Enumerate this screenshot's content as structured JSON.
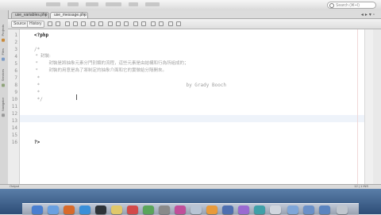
{
  "search": {
    "placeholder": "Search (⌘+I)"
  },
  "tabs": [
    {
      "label": "use_variables.php"
    },
    {
      "label": "use_message.php"
    }
  ],
  "side_panel": {
    "items": [
      "Projects",
      "Files",
      "Services",
      "Navigator"
    ]
  },
  "toolbar": {
    "source_label": "Source",
    "history_label": "History"
  },
  "editor": {
    "line_numbers": [
      "1",
      "2",
      "3",
      "4",
      "5",
      "6",
      "7",
      "8",
      "9",
      "10",
      "11",
      "12",
      "13",
      "14",
      "15",
      "16"
    ],
    "lines": {
      "l1": "<?php",
      "l3": "/*",
      "l4": " *  封裝:",
      "l5": " *        封裝是將抽象元素分門別類的流程，這些元素是由結構和行為所組成的；",
      "l6": " *        封裝的用意是為了將制定的抽象介面和它的實做給分隔開來。",
      "l7": " *",
      "l8": " *                                                   by Grady Booch",
      "l9": " *",
      "l10": " */",
      "l16": "?>"
    }
  },
  "status": {
    "output_label": "Output",
    "position": "12 | 1",
    "mode": "INS"
  },
  "colors": {
    "php_tag": "#1a1a1a",
    "comment": "#9f9f9f",
    "current_line": "#eef3fa"
  }
}
